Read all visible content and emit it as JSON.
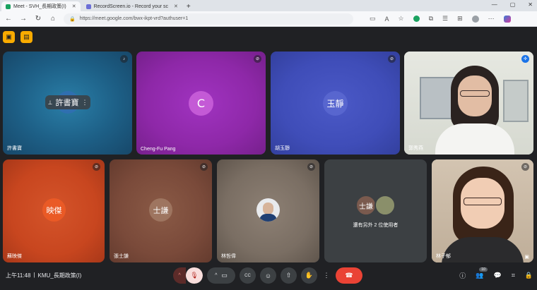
{
  "browser": {
    "tabs": [
      {
        "label": "Meet - SVH_長期政策(I)",
        "active": true,
        "color": "#1aa260"
      },
      {
        "label": "RecordScreen.io - Record your sc",
        "active": false,
        "color": "#6b6fd6"
      }
    ],
    "url": "https://meet.google.com/bwx-ikpt-vrd?authuser=1",
    "new_tab": "+",
    "window_controls": [
      "—",
      "▢",
      "✕"
    ]
  },
  "meeting": {
    "time": "上午11:48",
    "separator": "|",
    "title": "KMU_長期政策(I)",
    "participant_count": "10"
  },
  "tiles": [
    {
      "name": "許書寶",
      "initials": "許書寶",
      "color": "#1d5f86",
      "pinned_label": "許書寶"
    },
    {
      "name": "Cheng-Fu Pang",
      "initials": "C",
      "color": "#8e28a8"
    },
    {
      "name": "胡玉靜",
      "initials": "玉靜",
      "color": "#3f4db8"
    },
    {
      "name": "郭秀燕",
      "initials": "",
      "color": "#d9dcd4"
    },
    {
      "name": "蘇映傑",
      "initials": "映傑",
      "color": "#c8461f"
    },
    {
      "name": "張士謙",
      "initials": "士謙",
      "color": "#7a4a3a"
    },
    {
      "name": "林哲偉",
      "initials": "",
      "color": "#7a6e63"
    },
    {
      "name": "還有另外 2 位使用者",
      "initials": "士謙",
      "color": "#3c4043"
    },
    {
      "name": "林子郁",
      "initials": "",
      "color": "#c9b9a6"
    }
  ],
  "controls": {
    "mic_caret": "^",
    "mic_off": "🎙",
    "cam_caret": "^",
    "cam": "▭",
    "captions": "CC",
    "emoji": "☺",
    "present": "⇧",
    "hand": "✋",
    "more": "⋮",
    "leave": "☎"
  },
  "right_controls": [
    "ⓘ",
    "👥",
    "💬",
    "⌗",
    "🔒"
  ],
  "colors": {
    "accent": "#f9ab00",
    "leave": "#ea4335",
    "background": "#202124"
  }
}
